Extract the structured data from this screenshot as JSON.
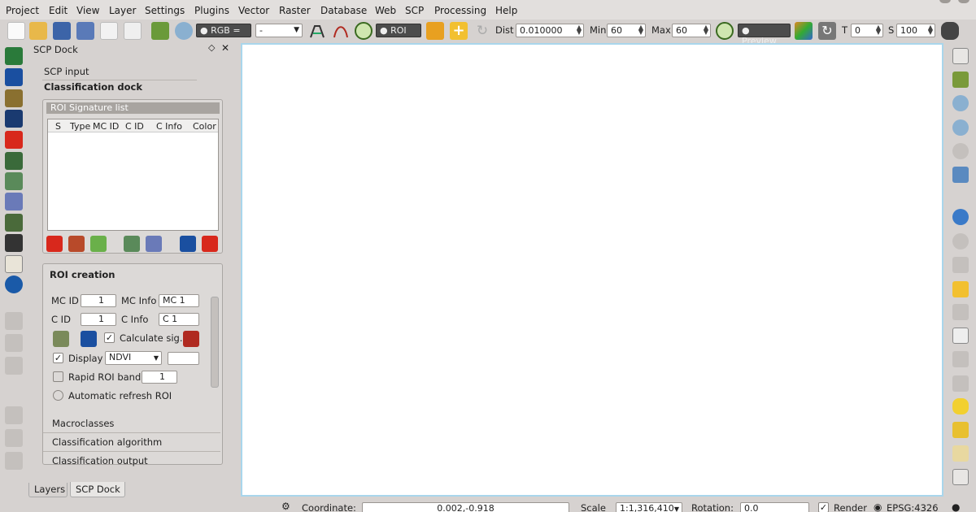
{
  "menu": {
    "items": [
      {
        "label": "Project"
      },
      {
        "label": "Edit"
      },
      {
        "label": "View"
      },
      {
        "label": "Layer"
      },
      {
        "label": "Settings"
      },
      {
        "label": "Plugins"
      },
      {
        "label": "Vector"
      },
      {
        "label": "Raster"
      },
      {
        "label": "Database"
      },
      {
        "label": "Web"
      },
      {
        "label": "SCP"
      },
      {
        "label": "Processing"
      },
      {
        "label": "Help"
      }
    ]
  },
  "toolbar": {
    "rgb_label": "RGB =",
    "rgb_value": "-",
    "roi_label": "ROI",
    "dist_label": "Dist",
    "dist_value": "0.010000",
    "min_label": "Min",
    "min_value": "60",
    "max_label": "Max",
    "max_value": "60",
    "preview_label": "Preview",
    "t_label": "T",
    "t_value": "0",
    "s_label": "S",
    "s_value": "100"
  },
  "dock": {
    "title": "SCP Dock",
    "tab_scp_input": "SCP input",
    "tab_classification_dock": "Classification dock",
    "roi_signature_list": "ROI Signature list",
    "columns": [
      "S",
      "Type",
      "MC ID",
      "C ID",
      "C Info",
      "Color"
    ],
    "roi_creation_title": "ROI creation",
    "mc_id_label": "MC ID",
    "mc_id_value": "1",
    "mc_info_label": "MC Info",
    "mc_info_value": "MC 1",
    "c_id_label": "C ID",
    "c_id_value": "1",
    "c_info_label": "C Info",
    "c_info_value": "C 1",
    "calculate_sig_label": "Calculate sig.",
    "display_label": "Display",
    "display_value": "NDVI",
    "rapid_roi_label": "Rapid ROI band",
    "rapid_roi_value": "1",
    "auto_refresh_label": "Automatic refresh ROI",
    "macroclasses": "Macroclasses",
    "classification_algorithm": "Classification algorithm",
    "classification_output": "Classification output"
  },
  "bottom_tabs": {
    "layers": "Layers",
    "scp_dock": "SCP Dock"
  },
  "statusbar": {
    "coordinate_label": "Coordinate:",
    "coordinate_value": "0.002,-0.918",
    "scale_label": "Scale",
    "scale_value": "1:1,316,410",
    "rotation_label": "Rotation:",
    "rotation_value": "0.0",
    "render_label": "Render",
    "epsg_label": "EPSG:4326"
  },
  "colors": {
    "canvas_border": "#a9d6ec",
    "panel_bg": "#d6d2d0",
    "accent_red": "#d8281c",
    "accent_blue": "#1a4fa0"
  }
}
